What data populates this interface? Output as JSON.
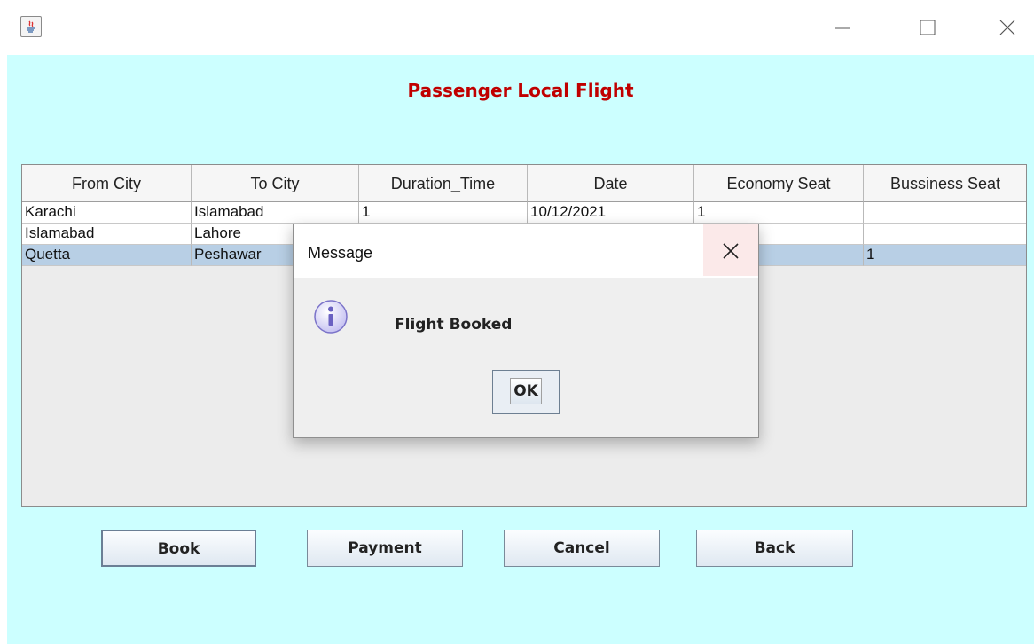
{
  "window": {
    "icon": "java-app-icon",
    "controls": [
      "minimize-icon",
      "maximize-icon",
      "close-icon"
    ]
  },
  "page": {
    "title": "Passenger Local Flight",
    "title_color": "#c00000",
    "background": "#ccffff"
  },
  "table": {
    "columns": [
      "From City",
      "To City",
      "Duration_Time",
      "Date",
      "Economy Seat",
      "Bussiness Seat"
    ],
    "rows": [
      {
        "from": "Karachi",
        "to": "Islamabad",
        "duration": "1",
        "date": "10/12/2021",
        "economy": "1",
        "business": ""
      },
      {
        "from": "Islamabad",
        "to": "Lahore",
        "duration": "",
        "date": "",
        "economy": "",
        "business": ""
      },
      {
        "from": "Quetta",
        "to": "Peshawar",
        "duration": "",
        "date": "",
        "economy": "",
        "business": "1"
      }
    ],
    "selected_row": 2,
    "selection_color": "#b8cfe5"
  },
  "buttons": {
    "book": "Book",
    "payment": "Payment",
    "cancel": "Cancel",
    "back": "Back"
  },
  "dialog": {
    "title": "Message",
    "message": "Flight Booked",
    "ok": "OK",
    "icon": "info-icon"
  }
}
